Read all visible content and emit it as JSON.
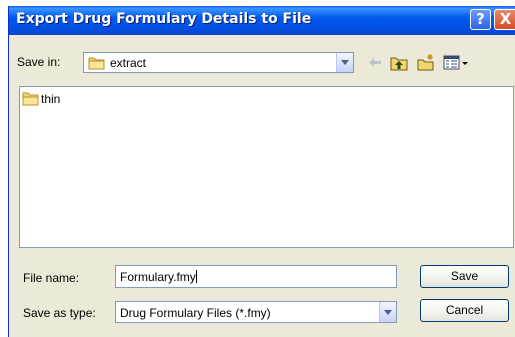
{
  "window": {
    "title": "Export Drug Formulary Details to File",
    "help_glyph": "?",
    "close_glyph": "X"
  },
  "toolbar": {
    "save_in_label": "Save in:",
    "save_in_value": "extract",
    "icons": [
      "folder-icon",
      "back-arrow-icon",
      "up-folder-icon",
      "new-folder-icon",
      "views-menu-icon"
    ]
  },
  "file_list": {
    "items": [
      {
        "name": "thin",
        "icon": "folder-icon"
      }
    ]
  },
  "form": {
    "file_name_label": "File name:",
    "file_name_value": "Formulary.fmy",
    "save_as_type_label": "Save as type:",
    "save_as_type_value": "Drug Formulary Files (*.fmy)",
    "save_button": "Save",
    "cancel_button": "Cancel"
  },
  "colors": {
    "title_bar": "#0054e3",
    "dialog_bg": "#ece9d8",
    "field_border": "#7f9db9",
    "folder": "#f5d56b"
  }
}
